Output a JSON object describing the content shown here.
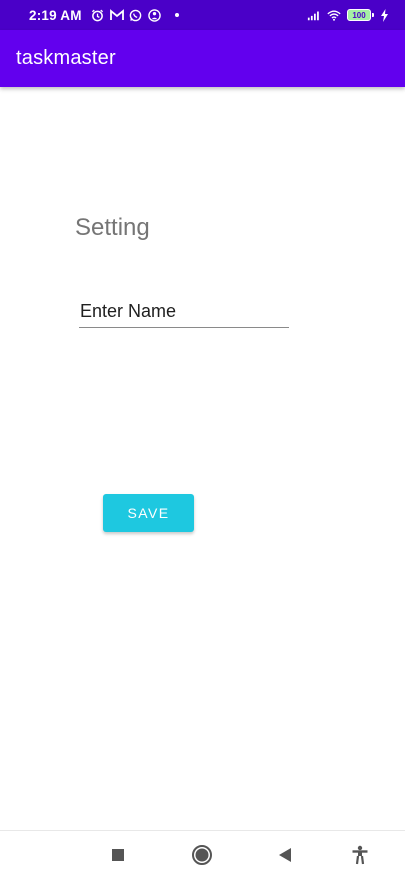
{
  "status_bar": {
    "time": "2:19 AM",
    "battery_level": "100",
    "icons": [
      "alarm-icon",
      "gmail-icon",
      "whatsapp-icon",
      "messenger-icon",
      "dot-icon",
      "signal-icon",
      "wifi-icon",
      "battery-icon",
      "charging-icon"
    ]
  },
  "app_bar": {
    "title": "taskmaster"
  },
  "main": {
    "heading": "Setting",
    "name_input": {
      "value": "",
      "placeholder": "Enter Name"
    },
    "save_label": "SAVE"
  },
  "nav_bar": {
    "icons": [
      "recents-icon",
      "home-icon",
      "back-icon",
      "accessibility-icon"
    ]
  },
  "colors": {
    "status_bar": "#4a00c8",
    "app_bar": "#6200ee",
    "save_button": "#1ec8e0",
    "heading_text": "#757575"
  }
}
